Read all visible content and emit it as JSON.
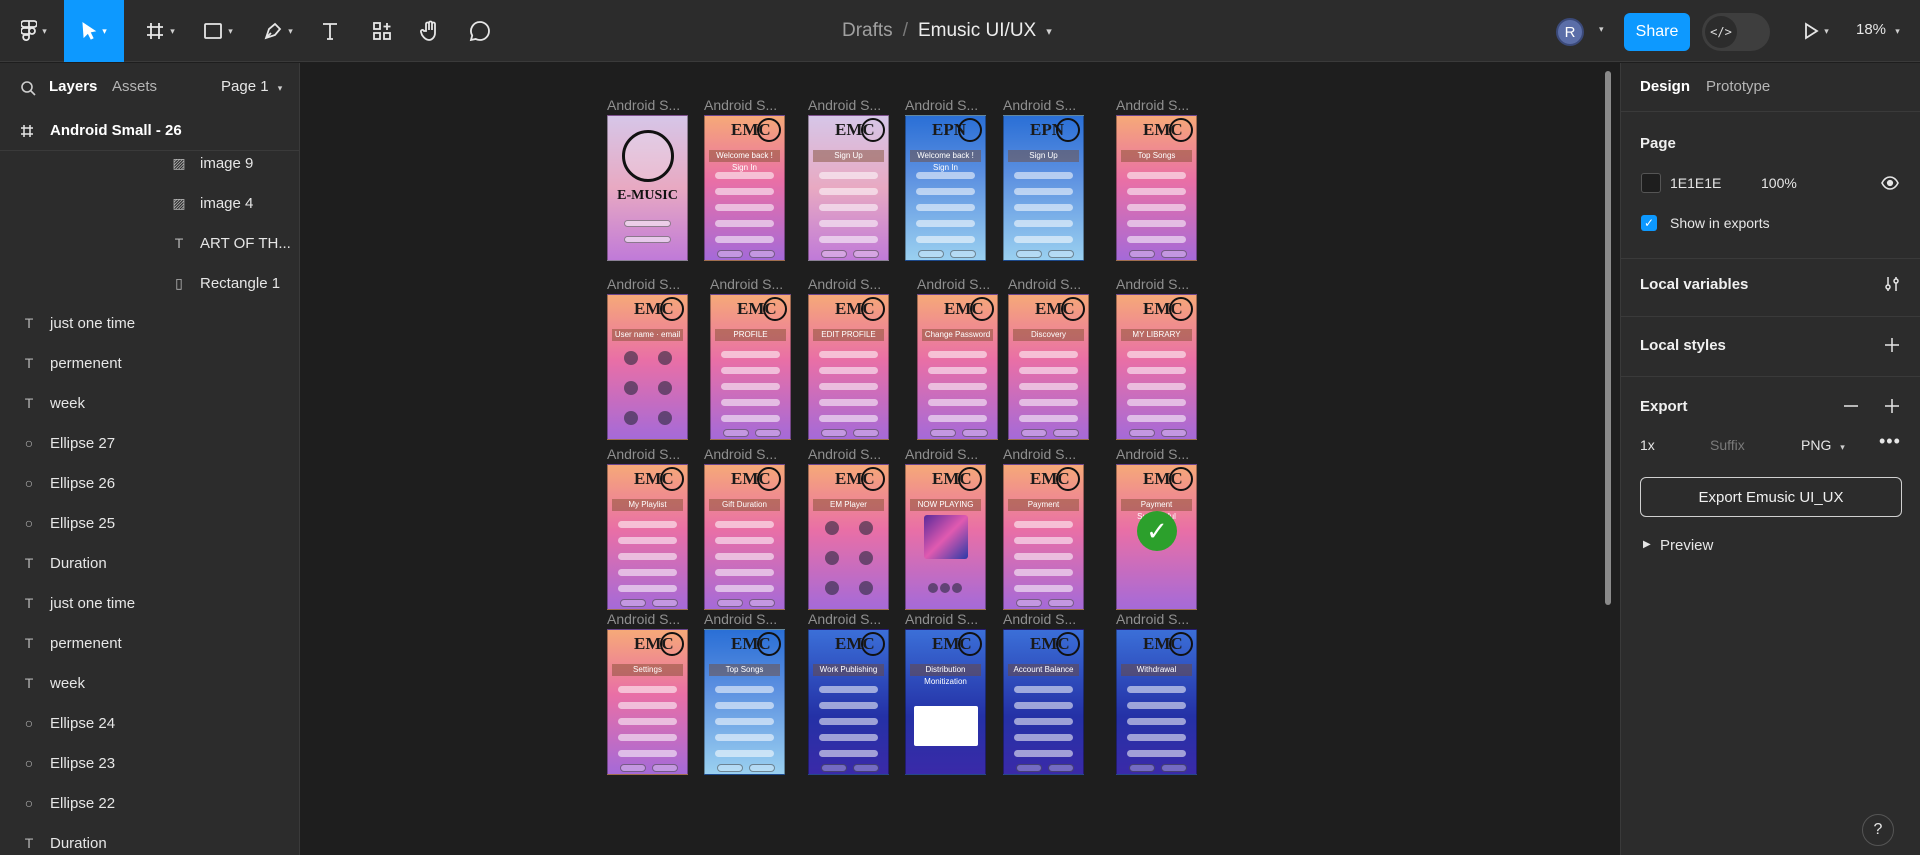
{
  "toolbar": {
    "breadcrumb_drafts": "Drafts",
    "breadcrumb_sep": "/",
    "file_name": "Emusic UI/UX",
    "avatar_initial": "R",
    "share_label": "Share",
    "dev_mode_glyph": "</>",
    "zoom": "18%",
    "icons": [
      "figma-menu-icon",
      "move-tool-icon",
      "frame-tool-icon",
      "shape-tool-icon",
      "pen-tool-icon",
      "text-tool-icon",
      "resources-icon",
      "hand-tool-icon",
      "comment-icon",
      "present-icon"
    ]
  },
  "left_panel": {
    "tab_layers": "Layers",
    "tab_assets": "Assets",
    "page_selector": "Page 1",
    "selected_frame": "Android Small - 26",
    "layers": [
      {
        "name": "image 9",
        "type": "image",
        "indent": 1
      },
      {
        "name": "image 4",
        "type": "image",
        "indent": 1
      },
      {
        "name": "ART OF TH...",
        "type": "text",
        "indent": 1
      },
      {
        "name": "Rectangle 1",
        "type": "rect",
        "indent": 1
      },
      {
        "name": "just one time",
        "type": "text",
        "indent": 0
      },
      {
        "name": "permenent",
        "type": "text",
        "indent": 0
      },
      {
        "name": "week",
        "type": "text",
        "indent": 0
      },
      {
        "name": "Ellipse 27",
        "type": "ellipse",
        "indent": 0
      },
      {
        "name": "Ellipse 26",
        "type": "ellipse",
        "indent": 0
      },
      {
        "name": "Ellipse 25",
        "type": "ellipse",
        "indent": 0
      },
      {
        "name": "Duration",
        "type": "text",
        "indent": 0
      },
      {
        "name": "just one time",
        "type": "text",
        "indent": 0
      },
      {
        "name": "permenent",
        "type": "text",
        "indent": 0
      },
      {
        "name": "week",
        "type": "text",
        "indent": 0
      },
      {
        "name": "Ellipse 24",
        "type": "ellipse",
        "indent": 0
      },
      {
        "name": "Ellipse 23",
        "type": "ellipse",
        "indent": 0
      },
      {
        "name": "Ellipse 22",
        "type": "ellipse",
        "indent": 0
      },
      {
        "name": "Duration",
        "type": "text",
        "indent": 0
      }
    ]
  },
  "canvas": {
    "frame_label": "Android S...",
    "rows": [
      [
        {
          "title": "E-MUSIC",
          "style": "g-lav",
          "kind": "splash"
        },
        {
          "title": "EMC",
          "style": "g-pink",
          "kind": "form",
          "bar": "Welcome back ! Sign In"
        },
        {
          "title": "EMC",
          "style": "g-lav",
          "kind": "form",
          "bar": "Sign Up"
        },
        {
          "title": "EPN",
          "style": "g-blue",
          "kind": "form",
          "bar": "Welcome back ! Sign In"
        },
        {
          "title": "EPN",
          "style": "g-blue",
          "kind": "form",
          "bar": "Sign Up"
        },
        {
          "title": "EMC",
          "style": "g-pink",
          "kind": "list",
          "bar": "Top Songs"
        }
      ],
      [
        {
          "title": "EMC",
          "style": "g-pink",
          "kind": "grid",
          "bar": "User name · email"
        },
        {
          "title": "EMC",
          "style": "g-pink",
          "kind": "form",
          "bar": "PROFILE"
        },
        {
          "title": "EMC",
          "style": "g-pink",
          "kind": "form",
          "bar": "EDIT PROFILE"
        },
        {
          "title": "EMC",
          "style": "g-pink",
          "kind": "form",
          "bar": "Change Password"
        },
        {
          "title": "EMC",
          "style": "g-pink",
          "kind": "form",
          "bar": "Discovery"
        },
        {
          "title": "EMC",
          "style": "g-pink",
          "kind": "list",
          "bar": "MY LIBRARY"
        }
      ],
      [
        {
          "title": "EMC",
          "style": "g-pink",
          "kind": "list",
          "bar": "My Playlist"
        },
        {
          "title": "EMC",
          "style": "g-pink",
          "kind": "list",
          "bar": "Gift Duration"
        },
        {
          "title": "EMC",
          "style": "g-pink",
          "kind": "grid",
          "bar": "EM Player"
        },
        {
          "title": "EMC",
          "style": "g-pink",
          "kind": "player",
          "bar": "NOW PLAYING"
        },
        {
          "title": "EMC",
          "style": "g-pink",
          "kind": "form",
          "bar": "Payment"
        },
        {
          "title": "EMC",
          "style": "g-pink",
          "kind": "success",
          "bar": "Payment Successful"
        }
      ],
      [
        {
          "title": "EMC",
          "style": "g-pink",
          "kind": "form",
          "bar": "Settings"
        },
        {
          "title": "EMC",
          "style": "g-blue",
          "kind": "list",
          "bar": "Top Songs"
        },
        {
          "title": "EMC",
          "style": "g-navy",
          "kind": "list",
          "bar": "Work Publishing"
        },
        {
          "title": "EMC",
          "style": "g-navy",
          "kind": "chart",
          "bar": "Distribution Monitization"
        },
        {
          "title": "EMC",
          "style": "g-navy",
          "kind": "list",
          "bar": "Account Balance"
        },
        {
          "title": "EMC",
          "style": "g-navy",
          "kind": "form",
          "bar": "Withdrawal"
        }
      ]
    ]
  },
  "right_panel": {
    "tab_design": "Design",
    "tab_prototype": "Prototype",
    "page_title": "Page",
    "page_color": "1E1E1E",
    "page_opacity": "100%",
    "show_in_exports": "Show in exports",
    "local_variables": "Local variables",
    "local_styles": "Local styles",
    "export_title": "Export",
    "export_scale": "1x",
    "export_suffix_placeholder": "Suffix",
    "export_format": "PNG",
    "export_button": "Export Emusic UI_UX",
    "preview": "Preview",
    "help": "?"
  }
}
